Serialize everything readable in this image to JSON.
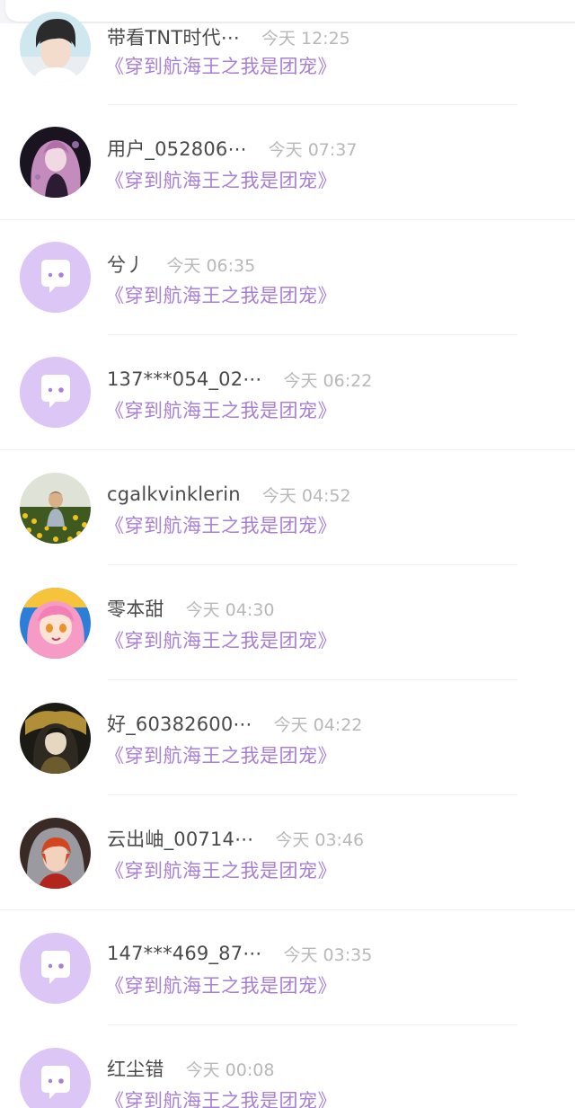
{
  "colors": {
    "accent_purple": "#a77fd6",
    "default_avatar_bg": "#dcc6f5",
    "name_color": "#4a4a4a",
    "time_color": "#b8b8b8"
  },
  "comments": [
    {
      "name": "带看TNT时代⋯",
      "time": "今天 12:25",
      "book": "《穿到航海王之我是团宠》",
      "avatar": "photo-boy"
    },
    {
      "name": "用户_052806⋯",
      "time": "今天 07:37",
      "book": "《穿到航海王之我是团宠》",
      "avatar": "anime-dark"
    },
    {
      "name": "兮丿",
      "time": "今天 06:35",
      "book": "《穿到航海王之我是团宠》",
      "avatar": "default-chat-icon"
    },
    {
      "name": "137***054_02⋯",
      "time": "今天 06:22",
      "book": "《穿到航海王之我是团宠》",
      "avatar": "default-chat-icon"
    },
    {
      "name": "cgalkvinklerin",
      "time": "今天 04:52",
      "book": "《穿到航海王之我是团宠》",
      "avatar": "photo-field"
    },
    {
      "name": "零本甜",
      "time": "今天 04:30",
      "book": "《穿到航海王之我是团宠》",
      "avatar": "anime-pink"
    },
    {
      "name": "好_60382600⋯",
      "time": "今天 04:22",
      "book": "《穿到航海王之我是团宠》",
      "avatar": "anime-gold"
    },
    {
      "name": "云出岫_00714⋯",
      "time": "今天 03:46",
      "book": "《穿到航海王之我是团宠》",
      "avatar": "anime-red"
    },
    {
      "name": "147***469_87⋯",
      "time": "今天 03:35",
      "book": "《穿到航海王之我是团宠》",
      "avatar": "default-chat-icon"
    },
    {
      "name": "红尘错",
      "time": "今天 00:08",
      "book": "《穿到航海王之我是团宠》",
      "avatar": "default-chat-icon"
    }
  ]
}
